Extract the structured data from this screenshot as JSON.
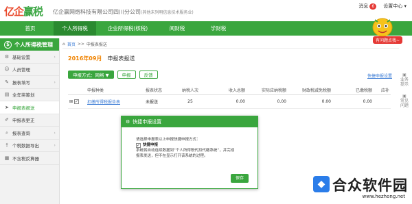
{
  "header": {
    "logo_text": "亿企",
    "logo_text2": "赢税",
    "company": "亿企赢网络科技有限公司四川分公司",
    "company_note": "(其他未列明信息技术服务业)",
    "messages_label": "消息",
    "messages_count": "6",
    "settings_label": "设置中心"
  },
  "nav": {
    "items": [
      {
        "label": "首页"
      },
      {
        "label": "个人所得税"
      },
      {
        "label": "企业所得税(核税)"
      },
      {
        "label": "阅财税"
      },
      {
        "label": "学财税"
      }
    ],
    "active_index": 1,
    "mascot_label": "有问题点我~"
  },
  "sidebar": {
    "title": "个人所得税管理",
    "items": [
      {
        "label": "基础设置",
        "icon": "wrench-icon",
        "glyph": "⚙",
        "has_arrow": true
      },
      {
        "label": "人员管理",
        "icon": "person-icon",
        "glyph": "☺",
        "has_arrow": false
      },
      {
        "label": "报表填写",
        "icon": "pencil-icon",
        "glyph": "✎",
        "has_arrow": true
      },
      {
        "label": "全年奖筹划",
        "icon": "doc-icon",
        "glyph": "▤",
        "has_arrow": false
      },
      {
        "label": "申报表报送",
        "icon": "send-icon",
        "glyph": "➤",
        "has_arrow": false,
        "active": true
      },
      {
        "label": "申报表更正",
        "icon": "edit-icon",
        "glyph": "✐",
        "has_arrow": false
      },
      {
        "label": "报表查询",
        "icon": "search-icon",
        "glyph": "⌕",
        "has_arrow": true
      },
      {
        "label": "个税数据导出",
        "icon": "export-icon",
        "glyph": "⇪",
        "has_arrow": true
      },
      {
        "label": "不含税反算器",
        "icon": "calculator-icon",
        "glyph": "▦",
        "has_arrow": false
      }
    ]
  },
  "breadcrumb": {
    "home": "首页",
    "sep": ">>",
    "current": "申报表报送"
  },
  "period": {
    "label": "2016年09月",
    "title": "申报表报送"
  },
  "toolbar": {
    "method_label": "申报方式：网络 ▼",
    "declare_label": "申报",
    "feedback_label": "反馈",
    "quick_link": "快捷申报设置"
  },
  "table": {
    "headers": [
      "",
      "申报种类",
      "报表状态",
      "纳税人次",
      "收入总额",
      "实际应纳税额",
      "财政税减免税额",
      "已缴税额",
      "应补"
    ],
    "row": {
      "expand": "⊞",
      "name": "扣缴所得税报告表",
      "status": "未报送",
      "count": "25",
      "income": "0.00",
      "tax": "0.00",
      "relief": "0.00",
      "paid": "0.00",
      "due": ""
    }
  },
  "modal": {
    "title": "快捷申报设置",
    "intro": "请选择申报表以上申报快捷申报方式：",
    "option": "快捷申报",
    "desc1": "系统将自动连续数据到“个人所得税代扣代缴系统”，并完成",
    "desc2": "报表发送，但不在显示打开该系统的过程。",
    "save": "保存"
  },
  "rightbar": {
    "item1": "业务提示",
    "item2": "常见问题"
  },
  "watermark": {
    "title": "合众软件园",
    "url": "www.hezhong.net"
  },
  "colors": {
    "brand_green": "#3aa63e",
    "link_blue": "#3a7bd5",
    "period_orange": "#f08300"
  }
}
